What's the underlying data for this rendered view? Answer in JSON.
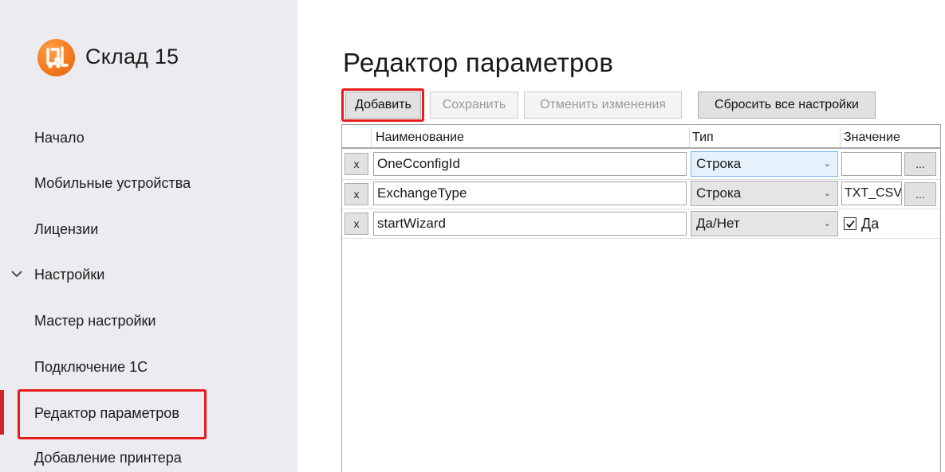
{
  "app": {
    "title": "Склад 15",
    "logo_icon": "forklift-logo-icon",
    "logo_color": "#f37a1f"
  },
  "sidebar": {
    "items": [
      {
        "label": "Начало"
      },
      {
        "label": "Мобильные устройства"
      },
      {
        "label": "Лицензии"
      },
      {
        "label": "Настройки",
        "expanded": true,
        "icon": "chevron-down-icon"
      },
      {
        "label": "Мастер настройки"
      },
      {
        "label": "Подключение 1С"
      },
      {
        "label": "Редактор параметров",
        "active": true
      },
      {
        "label": "Добавление принтера"
      }
    ],
    "active_color": "#d2232a"
  },
  "main": {
    "title": "Редактор параметров",
    "toolbar": {
      "add_label": "Добавить",
      "save_label": "Сохранить",
      "cancel_label": "Отменить изменения",
      "reset_label": "Сбросить все настройки"
    },
    "grid": {
      "columns": [
        "Наименование",
        "Тип",
        "Значение"
      ],
      "rows": [
        {
          "delete_label": "x",
          "name": "OneCconfigId",
          "type": "Строка",
          "value": "",
          "dots": "..."
        },
        {
          "delete_label": "x",
          "name": "ExchangeType",
          "type": "Строка",
          "value": "TXT_CSV",
          "dots": "..."
        },
        {
          "delete_label": "x",
          "name": "startWizard",
          "type": "Да/Нет",
          "checked": true,
          "check_label": "Да"
        }
      ]
    }
  },
  "highlight_color": "#e81a1a"
}
